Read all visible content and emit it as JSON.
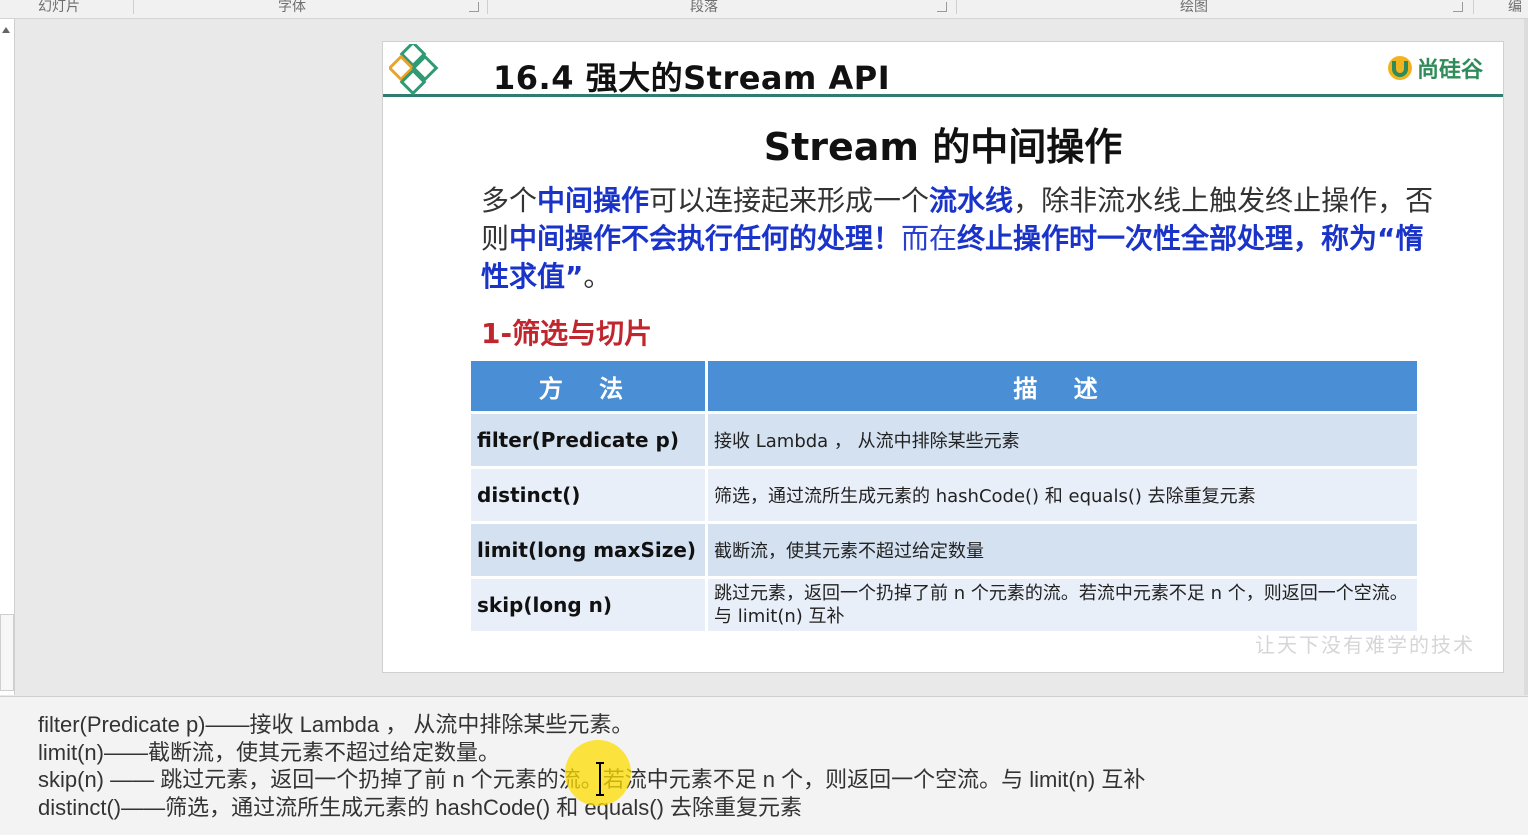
{
  "ribbon": {
    "groups": [
      "幻灯片",
      "字体",
      "段落",
      "绘图",
      "编"
    ]
  },
  "slide": {
    "title": "16.4 强大的Stream API",
    "brand": "尚硅谷",
    "heading": "Stream 的中间操作",
    "paragraph": {
      "p1": "多个",
      "p2": "中间操作",
      "p3": "可以连接起来形成一个",
      "p4": "流水线",
      "p5": "，除非流水线上触发终止操作，否则",
      "p6": "中间操作不会执行任何的处理！",
      "p7": "而在",
      "p8": "终止操作时一次性全部处理，称为“惰性求值”",
      "p9": "。"
    },
    "subheading": "1-筛选与切片",
    "table": {
      "headers": [
        "方 法",
        "描 述"
      ],
      "rows": [
        {
          "method": "filter(Predicate p)",
          "desc": "接收 Lambda ， 从流中排除某些元素"
        },
        {
          "method": "distinct()",
          "desc": "筛选，通过流所生成元素的 hashCode() 和 equals() 去除重复元素"
        },
        {
          "method": "limit(long maxSize)",
          "desc": "截断流，使其元素不超过给定数量"
        },
        {
          "method": "skip(long n)",
          "desc": "跳过元素，返回一个扔掉了前 n 个元素的流。若流中元素不足 n 个，则返回一个空流。与 limit(n) 互补"
        }
      ]
    },
    "watermark": "让天下没有难学的技术"
  },
  "notes": {
    "lines": [
      "filter(Predicate p)——接收 Lambda ， 从流中排除某些元素。",
      "limit(n)——截断流，使其元素不超过给定数量。",
      "skip(n) —— 跳过元素，返回一个扔掉了前 n 个元素的流。若流中元素不足 n 个，则返回一个空流。与 limit(n) 互补",
      "distinct()——筛选，通过流所生成元素的 hashCode() 和 equals() 去除重复元素"
    ]
  },
  "colors": {
    "accent_blue": "#1a33c9",
    "subhead_red": "#c0262d",
    "table_header": "#4a8fd6",
    "header_rule": "#2f7d6e",
    "cursor_highlight": "#ffdc00"
  }
}
